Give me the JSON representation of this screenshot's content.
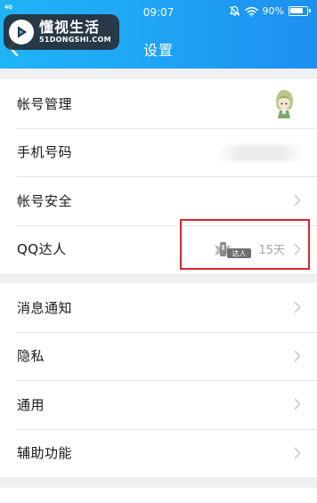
{
  "status_bar": {
    "signal": "4G",
    "time": "09:07",
    "battery_level": "90%"
  },
  "header": {
    "title": "设置"
  },
  "watermark": {
    "name_cn": "懂视生活",
    "name_en": "51DONGSHI.COM"
  },
  "settings": {
    "account_management": "帐号管理",
    "phone_number": "手机号码",
    "account_security": "帐号安全",
    "qq_daren": "QQ达人",
    "qq_daren_badge": "达人",
    "qq_daren_days": "15天",
    "message_notification": "消息通知",
    "privacy": "隐私",
    "general": "通用",
    "accessibility": "辅助功能"
  },
  "colors": {
    "header_blue": "#20a7f5",
    "highlight_red": "#d9272e",
    "chevron_gray": "#c7c7cc"
  }
}
